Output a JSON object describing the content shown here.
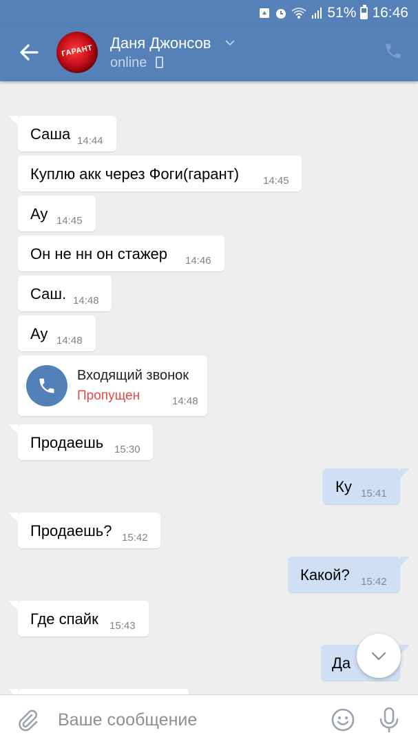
{
  "status_bar": {
    "battery_percent": "51%",
    "time": "16:46",
    "icons": [
      "recycle-icon",
      "alarm-icon",
      "wifi-icon",
      "signal-icon",
      "battery-icon"
    ]
  },
  "header": {
    "back_icon": "arrow-left-icon",
    "avatar_text": "ГАРАНТ",
    "contact_name": "Даня Джонсов",
    "contact_status": "online",
    "call_icon": "phone-icon"
  },
  "messages": [
    {
      "direction": "in",
      "text": "Саша",
      "time": "14:44"
    },
    {
      "direction": "in",
      "text": "Куплю акк через Фоги(гарант)",
      "time": "14:45"
    },
    {
      "direction": "in",
      "text": "Ау",
      "time": "14:45"
    },
    {
      "direction": "in",
      "text": "Он не нн он стажер",
      "time": "14:46"
    },
    {
      "direction": "in",
      "text": "Саш.",
      "time": "14:48"
    },
    {
      "direction": "in",
      "text": "Ау",
      "time": "14:48"
    },
    {
      "direction": "in",
      "type": "call",
      "title": "Входящий звонок",
      "subtitle": "Пропущен",
      "time": "14:48"
    },
    {
      "direction": "in",
      "text": "Продаешь",
      "time": "15:30"
    },
    {
      "direction": "out",
      "text": "Ку",
      "time": "15:41"
    },
    {
      "direction": "in",
      "text": "Продаешь?",
      "time": "15:42"
    },
    {
      "direction": "out",
      "text": "Какой?",
      "time": "15:42"
    },
    {
      "direction": "in",
      "text": "Где спайк",
      "time": "15:43"
    },
    {
      "direction": "out",
      "text": "Да",
      "time": ""
    }
  ],
  "input_bar": {
    "placeholder": "Ваше сообщение",
    "icons": [
      "paperclip-icon",
      "emoji-icon",
      "microphone-icon"
    ]
  },
  "colors": {
    "header": "#5580b8",
    "background": "#edeef0",
    "incoming_bubble": "#ffffff",
    "outgoing_bubble": "#cfe0f4",
    "missed_call": "#e64646"
  }
}
